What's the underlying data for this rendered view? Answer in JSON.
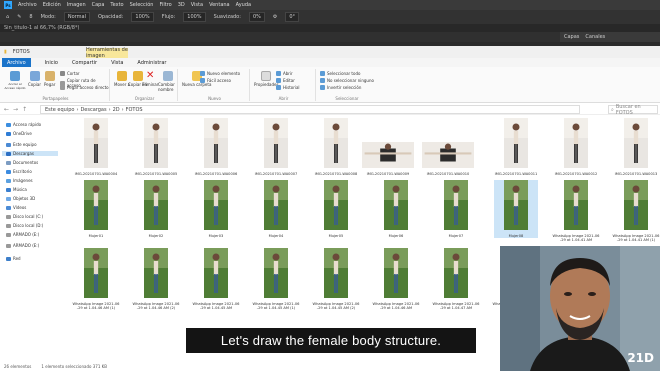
{
  "photoshop": {
    "logo": "Ps",
    "menu": [
      "Archivo",
      "Edición",
      "Imagen",
      "Capa",
      "Texto",
      "Selección",
      "Filtro",
      "3D",
      "Vista",
      "Ventana",
      "Ayuda"
    ],
    "options": {
      "brush_size": "8",
      "mode_label": "Modo:",
      "mode_value": "Normal",
      "opacity_label": "Opacidad:",
      "opacity_value": "100%",
      "flow_label": "Flujo:",
      "flow_value": "100%",
      "smooth_label": "Suavizado:",
      "smooth_value": "0%",
      "angle_value": "0°"
    },
    "doc_tab": "Sin_titulo-1 al 66,7% (RGB/8*)",
    "right_tabs": [
      "Capas",
      "Canales"
    ]
  },
  "explorer": {
    "title": "FOTOS",
    "context_tab": "Herramientas de imagen",
    "ribbon_tabs": [
      "Archivo",
      "Inicio",
      "Compartir",
      "Vista",
      "Administrar"
    ],
    "ribbon": {
      "pin": "Anclar al Acceso rápido",
      "copy": "Copiar",
      "paste": "Pegar",
      "cut": "Cortar",
      "copy_path": "Copiar ruta de acceso",
      "paste_shortcut": "Pegar acceso directo",
      "move_to": "Mover a",
      "copy_to": "Copiar en",
      "delete": "Eliminar",
      "rename": "Cambiar nombre",
      "new_folder": "Nueva carpeta",
      "new_item": "Nuevo elemento",
      "easy_access": "Fácil acceso",
      "properties": "Propiedades",
      "open": "Abrir",
      "edit": "Editar",
      "history": "Historial",
      "select_all": "Seleccionar todo",
      "select_none": "No seleccionar ninguno",
      "invert": "Invertir selección",
      "group_clipboard": "Portapapeles",
      "group_organize": "Organizar",
      "group_new": "Nuevo",
      "group_open": "Abrir",
      "group_select": "Seleccionar"
    },
    "address": [
      "Este equipo",
      "Descargas",
      "2D",
      "FOTOS"
    ],
    "search_placeholder": "Buscar en FOTOS",
    "nav": [
      "Acceso rápido",
      "OneDrive",
      "Este equipo",
      "Descargas",
      "Documentos",
      "Escritorio",
      "Imágenes",
      "Música",
      "Objetos 3D",
      "Vídeos",
      "Disco local (C:)",
      "Disco local (D:)",
      "ARMADO (E:)",
      "ARMADO (E:)",
      "Red"
    ],
    "row1_labels": [
      "IMG-20210701-WA0004",
      "IMG-20210701-WA0005",
      "IMG-20210701-WA0006",
      "IMG-20210701-WA0007",
      "IMG-20210701-WA0008",
      "IMG-20210701-WA0009",
      "IMG-20210701-WA0010",
      "IMG-20210701-WA0011",
      "IMG-20210701-WA0012",
      "IMG-20210701-WA0013"
    ],
    "row2_labels": [
      "Mujer01",
      "Mujer02",
      "Mujer03",
      "Mujer04",
      "Mujer05",
      "Mujer06",
      "Mujer07",
      "Mujer08",
      "WhatsApp Image 2021-06-29 at 1.04.41 AM",
      "WhatsApp Image 2021-06-29 at 1.04.41 AM (1)"
    ],
    "row3_labels": [
      "WhatsApp Image 2021-06-29 at 1.04.46 AM (1)",
      "WhatsApp Image 2021-06-29 at 1.04.46 AM (2)",
      "WhatsApp Image 2021-06-29 at 1.04.45 AM",
      "WhatsApp Image 2021-06-29 at 1.04.45 AM (1)",
      "WhatsApp Image 2021-06-29 at 1.04.45 AM (2)",
      "WhatsApp Image 2021-06-29 at 1.04.46 AM",
      "WhatsApp Image 2021-06-29 at 1.04.47 AM",
      "WhatsApp Image 2021-06-29 at 1.04.48 AM"
    ],
    "status": {
      "count": "26 elementos",
      "selected": "1 elemento seleccionado  371 KB"
    }
  },
  "overlay": {
    "subtitle": "Let's draw the female body structure.",
    "logo": "21D"
  }
}
